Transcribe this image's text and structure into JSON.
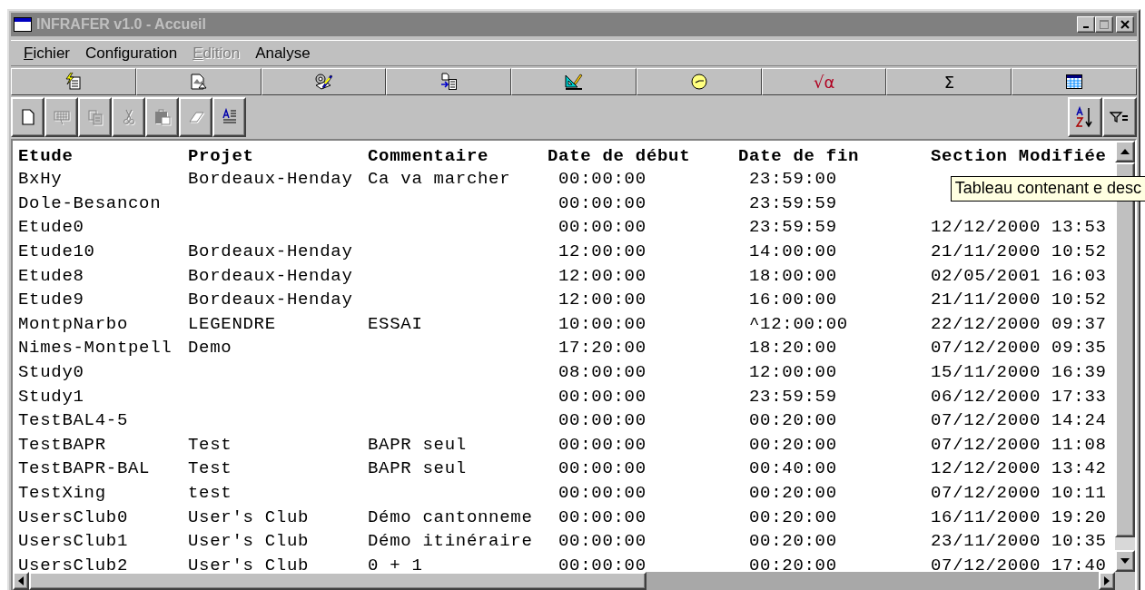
{
  "window": {
    "title": "INFRAFER v1.0 - Accueil",
    "active": false
  },
  "menu": [
    {
      "label": "Fichier",
      "underline_first": true,
      "disabled": false
    },
    {
      "label": "Configuration",
      "underline_first": false,
      "disabled": false
    },
    {
      "label": "Edition",
      "underline_first": true,
      "disabled": true
    },
    {
      "label": "Analyse",
      "underline_first": false,
      "disabled": false
    }
  ],
  "modules": [
    {
      "kind": "icon"
    },
    {
      "kind": "icon"
    },
    {
      "kind": "icon"
    },
    {
      "kind": "icon"
    },
    {
      "kind": "icon"
    },
    {
      "kind": "icon"
    },
    {
      "kind": "glyph",
      "label": "√α"
    },
    {
      "kind": "glyph",
      "label": "Σ"
    },
    {
      "kind": "icon"
    }
  ],
  "toolbar": {
    "buttons": [
      {
        "disabled": false
      },
      {
        "disabled": true
      },
      {
        "disabled": true
      },
      {
        "disabled": true
      },
      {
        "disabled": true
      },
      {
        "disabled": true
      },
      {
        "disabled": false
      }
    ]
  },
  "table": {
    "columns": [
      "Etude",
      "Projet",
      "Commentaire",
      "Date de début",
      "Date de fin",
      "Section Modifiée"
    ],
    "rows": [
      [
        "BxHy",
        "Bordeaux-Henday",
        "Ca va marcher",
        "00:00:00",
        "23:59:00"
      ],
      [
        "Dole-Besancon",
        "",
        "",
        "00:00:00",
        "23:59:59"
      ],
      [
        "Etude0",
        "",
        "",
        "00:00:00",
        "23:59:59",
        "12/12/2000 13:53"
      ],
      [
        "Etude10",
        "Bordeaux-Henday",
        "",
        "12:00:00",
        "14:00:00",
        "21/11/2000 10:52"
      ],
      [
        "Etude8",
        "Bordeaux-Henday",
        "",
        "12:00:00",
        "18:00:00",
        "02/05/2001 16:03"
      ],
      [
        "Etude9",
        "Bordeaux-Henday",
        "",
        "12:00:00",
        "16:00:00",
        "21/11/2000 10:52"
      ],
      [
        "MontpNarbo",
        "LEGENDRE",
        "ESSAI",
        "10:00:00",
        "^12:00:00",
        "22/12/2000 09:37"
      ],
      [
        "Nimes-Montpell",
        "Demo",
        "",
        "17:20:00",
        "18:20:00",
        "07/12/2000 09:35"
      ],
      [
        "Study0",
        "",
        "",
        "08:00:00",
        "12:00:00",
        "15/11/2000 16:39"
      ],
      [
        "Study1",
        "",
        "",
        "00:00:00",
        "23:59:59",
        "06/12/2000 17:33"
      ],
      [
        "TestBAL4-5",
        "",
        "",
        "00:00:00",
        "00:20:00",
        "07/12/2000 14:24"
      ],
      [
        "TestBAPR",
        "Test",
        "BAPR seul",
        "00:00:00",
        "00:20:00",
        "07/12/2000 11:08"
      ],
      [
        "TestBAPR-BAL",
        "Test",
        "BAPR seul",
        "00:00:00",
        "00:40:00",
        "12/12/2000 13:42"
      ],
      [
        "TestXing",
        "test",
        "",
        "00:00:00",
        "00:20:00",
        "07/12/2000 10:11"
      ],
      [
        "UsersClub0",
        "User's Club",
        "Démo cantonneme",
        "00:00:00",
        "00:20:00",
        "16/11/2000 19:20"
      ],
      [
        "UsersClub1",
        "User's Club",
        "Démo itinéraire",
        "00:00:00",
        "00:20:00",
        "23/11/2000 10:35"
      ],
      [
        "UsersClub2",
        "User's Club",
        "0 + 1",
        "00:00:00",
        "00:20:00",
        "07/12/2000 17:40"
      ]
    ]
  },
  "tooltip": {
    "text": "Tableau contenant e desc"
  }
}
